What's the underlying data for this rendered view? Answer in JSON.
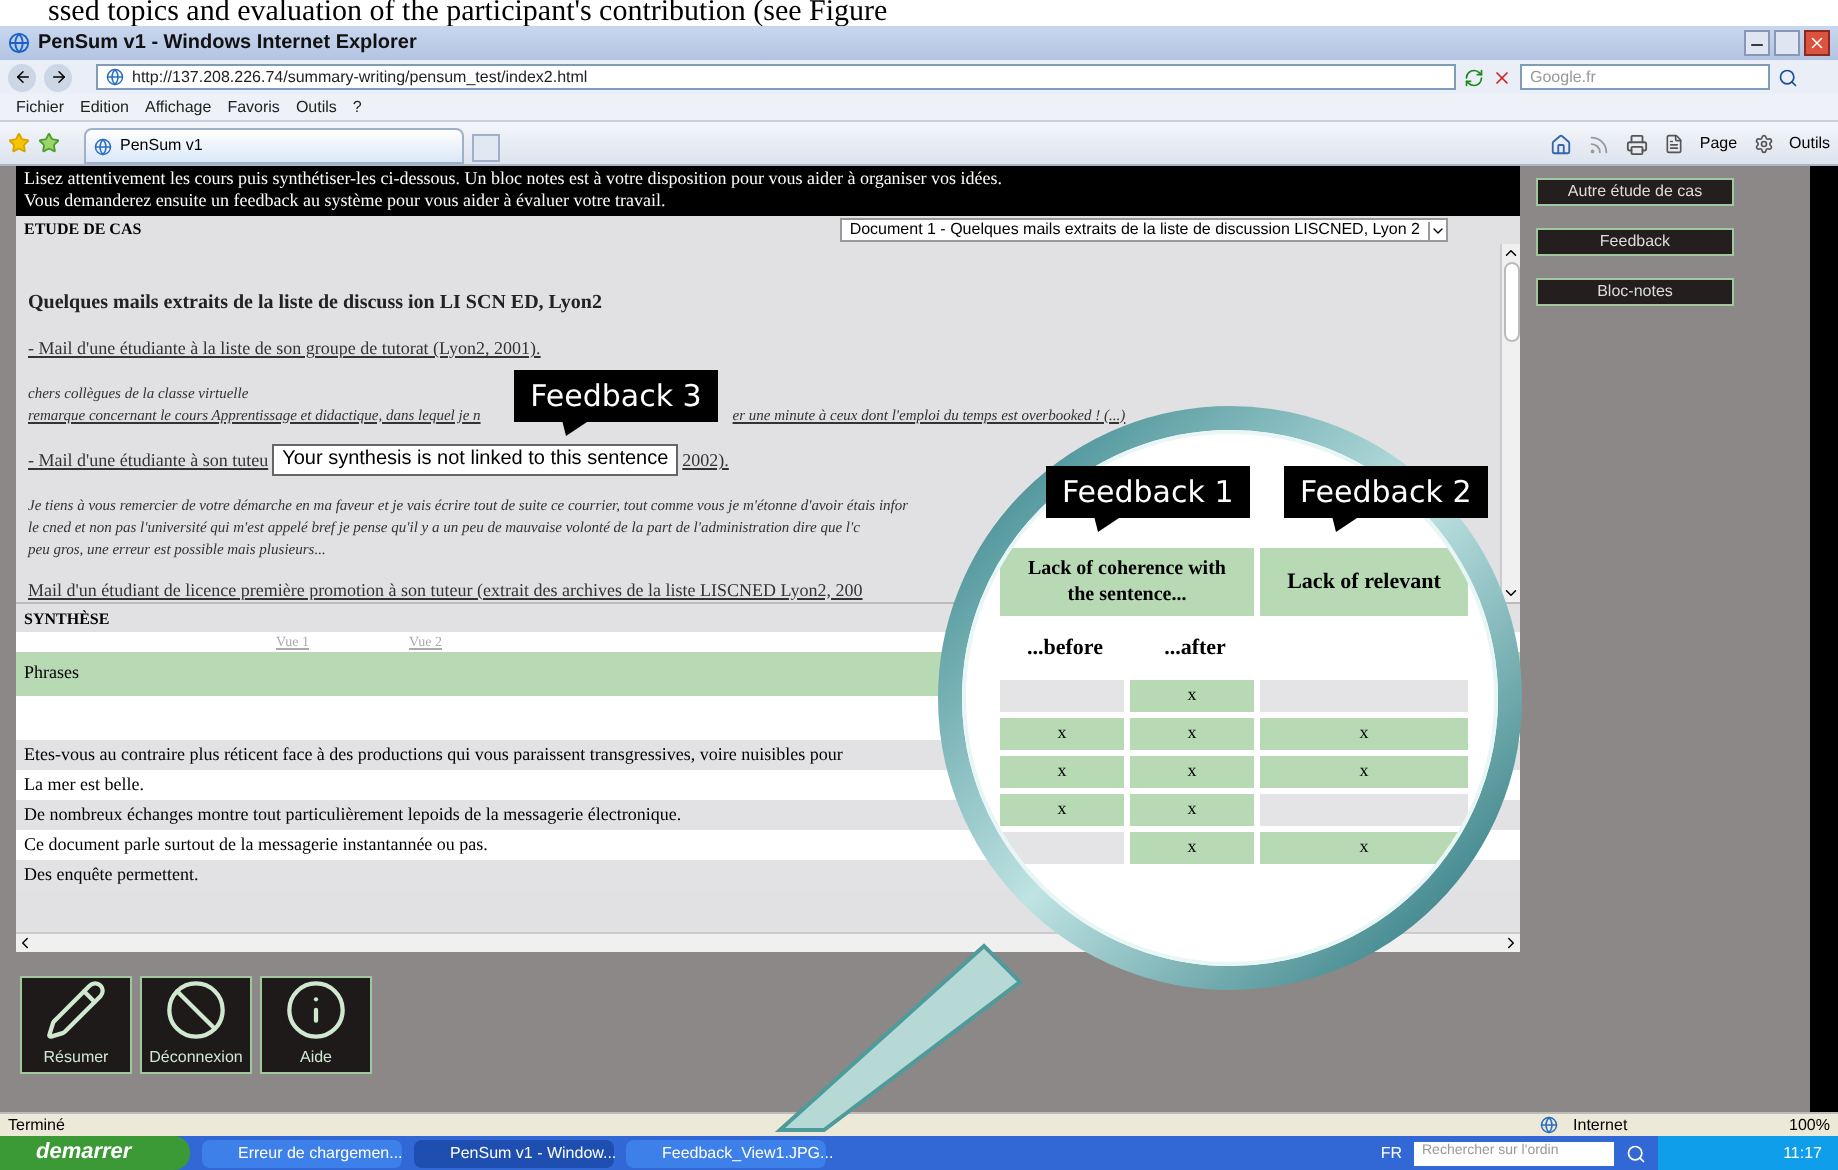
{
  "caption_fragment": "ssed topics and evaluation of the participant's contribution (see Figure",
  "window": {
    "title": "PenSum v1 - Windows Internet Explorer"
  },
  "address_bar": {
    "url": "http://137.208.226.74/summary-writing/pensum_test/index2.html"
  },
  "search": {
    "placeholder": "Google.fr"
  },
  "menu": [
    "Fichier",
    "Edition",
    "Affichage",
    "Favoris",
    "Outils",
    "?"
  ],
  "tabs": [
    {
      "label": "PenSum v1",
      "selected": true
    }
  ],
  "command_bar": [
    "Page",
    "Outils"
  ],
  "instructions": [
    "Lisez attentivement les cours puis synthétiser-les ci-dessous. Un bloc notes est à votre disposition pour vous aider à organiser vos idées.",
    "Vous demanderez ensuite un feedback au système pour vous aider à évaluer votre travail."
  ],
  "case_study": {
    "heading": "ETUDE DE CAS",
    "document_select": "Document 1 - Quelques mails extraits de la liste de discussion LISCNED, Lyon 2",
    "title": "Quelques mails extraits de la liste de discuss ion LI SCN ED, Lyon2",
    "blocks": [
      {
        "kind": "link",
        "parts": [
          "- Mail d'une étudiante à la liste de son groupe de tutorat (Lyon2, 2001)."
        ]
      },
      {
        "kind": "quote",
        "lines": [
          [
            "chers collègues de la classe virtuelle"
          ],
          [
            "remarque concernant le cours Apprentissage et didactique, dans lequel je n",
            "er une minute à ceux dont l'emploi du temps est overbooked ! (...)"
          ]
        ]
      },
      {
        "kind": "link",
        "parts": [
          "- Mail d'une étudiante à son tuteu",
          "2002)."
        ]
      },
      {
        "kind": "quote",
        "lines": [
          [
            "Je tiens à vous remercier de votre démarche en ma faveur et je vais écrire tout de suite ce courrier, tout comme vous je m'étonne d'avoir étais infor"
          ],
          [
            "le cned et non pas l'université qui m'est appelé bref je pense qu'il y a un peu de mauvaise volonté de la part de l'administration dire que l'c"
          ],
          [
            "peu gros, une erreur est possible mais plusieurs..."
          ]
        ]
      },
      {
        "kind": "link",
        "parts": [
          "Mail d'un étudiant de licence première promotion à son tuteur (extrait des archives de la liste LISCNED Lyon2, 200"
        ]
      }
    ]
  },
  "side_buttons": [
    "Autre étude de cas",
    "Feedback",
    "Bloc-notes"
  ],
  "synthesis": {
    "heading": "SYNTHÈSE",
    "views": [
      "Vue 1",
      "Vue 2"
    ],
    "column": "Phrases",
    "sentences": [
      "Etes-vous au contraire plus réticent face à des productions qui vous paraissent transgressives, voire nuisibles pour",
      "La mer est belle.",
      "De nombreux échanges montre tout particulièrement lepoids de la messagerie électronique.",
      "Ce document parle surtout de la messagerie instantannée ou pas.",
      "Des enquête permettent."
    ]
  },
  "lens_table": {
    "group_heading": "Lack of coherence with the sentence...",
    "second_heading": "Lack of relevant",
    "subheadings": [
      "...before",
      "...after"
    ],
    "rows": [
      {
        "cells": [
          {
            "marked": false
          },
          {
            "marked": true,
            "text": "x"
          },
          {
            "marked": false
          }
        ]
      },
      {
        "cells": [
          {
            "marked": true,
            "text": "x"
          },
          {
            "marked": true,
            "text": "x"
          },
          {
            "marked": true,
            "text": "x"
          }
        ]
      },
      {
        "cells": [
          {
            "marked": true,
            "text": "x"
          },
          {
            "marked": true,
            "text": "x"
          },
          {
            "marked": true,
            "text": "x"
          }
        ]
      },
      {
        "cells": [
          {
            "marked": true,
            "text": "x"
          },
          {
            "marked": true,
            "text": "x"
          },
          {
            "marked": false
          }
        ]
      },
      {
        "cells": [
          {
            "marked": false
          },
          {
            "marked": true,
            "text": "x"
          },
          {
            "marked": true,
            "text": "x"
          }
        ]
      }
    ]
  },
  "callouts": [
    {
      "label": "Feedback 3",
      "tooltip": "Your synthesis is not linked to this sentence"
    },
    {
      "label": "Feedback 1"
    },
    {
      "label": "Feedback 2"
    }
  ],
  "tool_buttons": [
    {
      "kind": "pencil",
      "label": "Résumer"
    },
    {
      "kind": "ban",
      "label": "Déconnexion"
    },
    {
      "kind": "info",
      "label": "Aide"
    }
  ],
  "status_bar": {
    "text": "Terminé",
    "zone": "Internet",
    "zoom": "100%"
  },
  "taskbar": {
    "start": "demarrer",
    "tasks": [
      {
        "label": "Erreur de chargemen...",
        "selected": false
      },
      {
        "label": "PenSum v1 - Window...",
        "selected": true
      },
      {
        "label": "Feedback_View1.JPG...",
        "selected": false
      }
    ],
    "language": "FR",
    "search_placeholder": "Rechercher sur l'ordin",
    "clock": "11:17"
  }
}
